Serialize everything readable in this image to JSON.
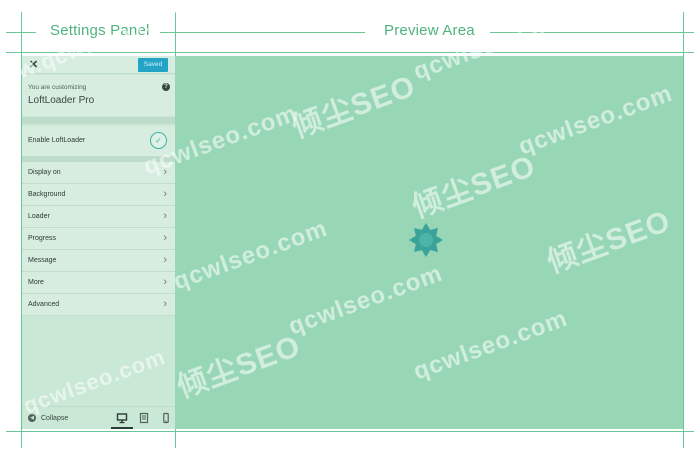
{
  "headings": {
    "settings": "Settings Panel",
    "preview": "Preview Area"
  },
  "panel": {
    "close_icon": "✕",
    "saved_label": "Saved",
    "customizing_label": "You are customizing",
    "customizing_title": "LoftLoader Pro",
    "help_icon": "?",
    "enable_label": "Enable LoftLoader",
    "enable_checked": true,
    "check_icon": "✓",
    "menu": [
      {
        "label": "Display on"
      },
      {
        "label": "Background"
      },
      {
        "label": "Loader"
      },
      {
        "label": "Progress"
      },
      {
        "label": "Message"
      },
      {
        "label": "More"
      },
      {
        "label": "Advanced"
      }
    ],
    "chevron_icon": "›",
    "collapse_label": "Collapse",
    "collapse_icon": "◀",
    "devices": [
      "desktop-icon",
      "tablet-icon",
      "mobile-icon"
    ],
    "active_device": "desktop"
  },
  "watermark": {
    "cn": "倾尘SEO",
    "url": "www.qcwlseo.com",
    "url_short": "qcwlseo.com"
  },
  "colors": {
    "accent": "#23a3c6",
    "preview_bg": "#98d7b6",
    "panel_bg": "#c9e8d6",
    "loader": "#3aa39a",
    "guide": "#6cc596"
  }
}
